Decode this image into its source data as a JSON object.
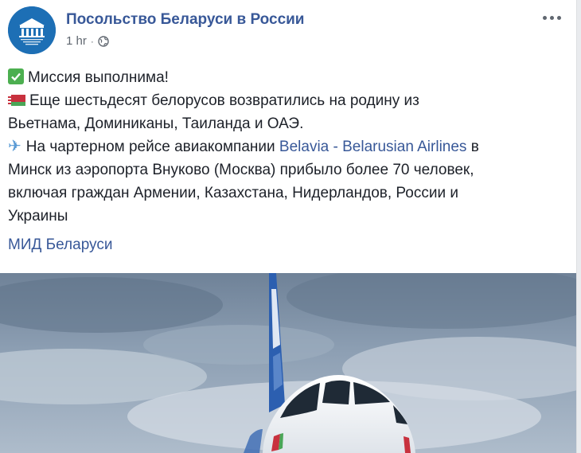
{
  "post": {
    "page_name": "Посольство Беларуси в России",
    "time": "1 hr",
    "separator": "·",
    "privacy_icon": "globe-icon",
    "more_icon": "more-options-icon",
    "avatar_text": "ПОСОЛЬСТВО БЕЛАРУСИ В РОССИИ",
    "line1": "Миссия выполнима!",
    "line2": "Еще шестьдесят белорусов возвратились на родину из",
    "line3": "Вьетнама, Доминиканы, Таиланда и ОАЭ.",
    "line4_pre": "На чартерном рейсе авиакомпании ",
    "line4_link": "Belavia - Belarusian Airlines",
    "line4_post": " в",
    "line5": "Минск из аэропорта Внуково (Москва) прибыло более 70 человек,",
    "line6": "включая граждан Армении, Казахстана, Нидерландов, России и",
    "line7": "Украины",
    "hashtag_link": "МИД Беларуси"
  },
  "colors": {
    "link": "#385898",
    "text": "#1d2129",
    "meta": "#606770",
    "avatar_bg": "#1d6fb5"
  }
}
